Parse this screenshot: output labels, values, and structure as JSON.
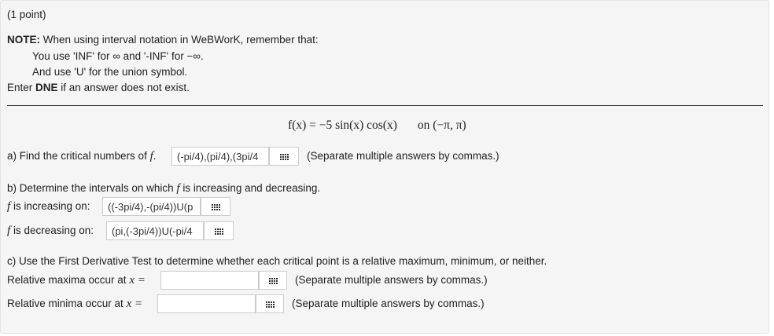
{
  "header": {
    "points": "(1 point)"
  },
  "note": {
    "label": "NOTE:",
    "line1": "When using interval notation in WeBWorK, remember that:",
    "line2": "You use 'INF' for ∞ and '-INF' for −∞.",
    "line3": "And use 'U' for the union symbol.",
    "line4_pre": "Enter ",
    "line4_bold": "DNE",
    "line4_post": " if an answer does not exist."
  },
  "function": {
    "expr": "f(x) = −5 sin(x) cos(x)",
    "domain": "on (−π, π)"
  },
  "part_a": {
    "prompt": "a) Find the critical numbers of",
    "var": "f",
    "dot": ".",
    "answer": "(-pi/4),(pi/4),(3pi/4",
    "hint": "(Separate multiple answers by commas.)"
  },
  "part_b": {
    "prompt_pre": "b) Determine the intervals on which",
    "var": "f",
    "prompt_post": "is increasing and decreasing.",
    "inc_label": "is increasing on:",
    "inc_answer": "((-3pi/4),-(pi/4))U(p",
    "dec_label": "is decreasing on:",
    "dec_answer": "(pi,(-3pi/4))U(-pi/4"
  },
  "part_c": {
    "prompt": "c) Use the First Derivative Test to determine whether each critical point is a relative maximum, minimum, or neither.",
    "max_label": "Relative maxima occur at",
    "min_label": "Relative minima occur at",
    "xeq": "x =",
    "max_answer": "",
    "min_answer": "",
    "hint": "(Separate multiple answers by commas.)"
  },
  "icons": {
    "equation_editor": "grid-icon"
  }
}
